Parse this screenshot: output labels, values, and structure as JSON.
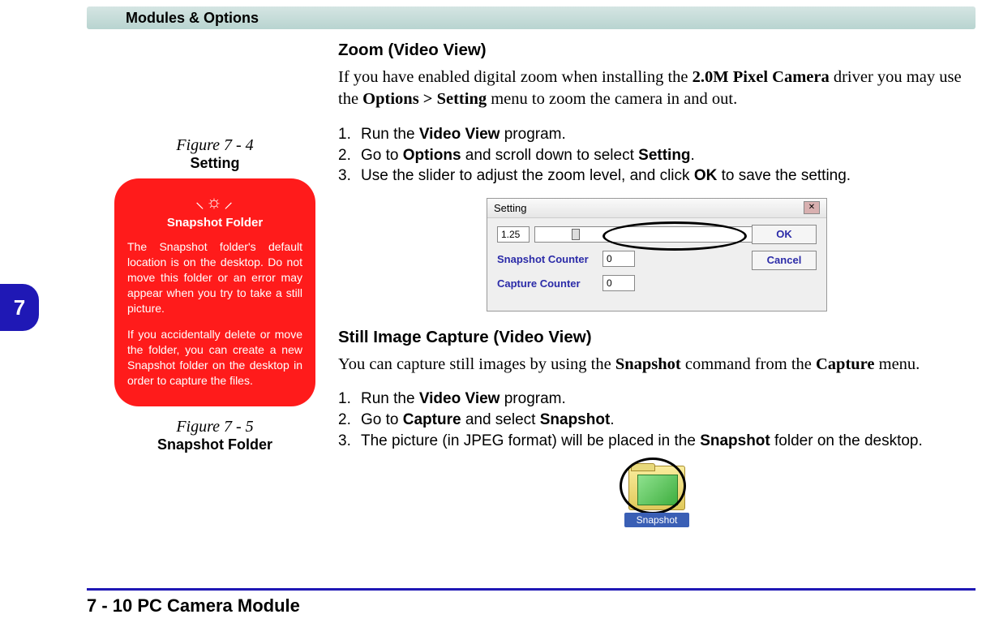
{
  "header": {
    "title": "Modules & Options"
  },
  "chapter": {
    "num": "7"
  },
  "figures": {
    "4": {
      "label": "Figure 7 - 4",
      "caption": "Setting"
    },
    "5": {
      "label": "Figure 7 - 5",
      "caption": "Snapshot Folder"
    }
  },
  "warning": {
    "title": "Snapshot Folder",
    "p1": "The Snapshot folder's default location is on the desktop. Do not move this folder or an error may appear when you try to take a still picture.",
    "p2": "If you accidentally delete or move the folder, you can create a new Snapshot folder on the desktop in order to capture the files."
  },
  "main": {
    "zoom": {
      "heading": "Zoom (Video View)",
      "intro_a": "If you have enabled digital zoom when installing the ",
      "bold1": "2.0M Pixel Camera",
      "intro_b": " driver you may use the ",
      "bold2": "Options > Setting",
      "intro_c": " menu to zoom the camera in and out.",
      "steps": {
        "1a": "Run the ",
        "1b": "Video View",
        "1c": " program.",
        "2a": "Go to ",
        "2b": "Options",
        "2c": " and scroll down to select ",
        "2d": "Setting",
        "2e": ".",
        "3a": "Use the slider to adjust the zoom level, and click ",
        "3b": "OK",
        "3c": " to save the setting."
      }
    },
    "still": {
      "heading": "Still Image Capture (Video View)",
      "intro_a": "You can capture still images by using the ",
      "bold1": "Snapshot",
      "intro_b": " command from the ",
      "bold2": "Capture",
      "intro_c": " menu.",
      "steps": {
        "1a": "Run the ",
        "1b": "Video View",
        "1c": " program.",
        "2a": "Go to ",
        "2b": "Capture",
        "2c": " and select ",
        "2d": "Snapshot",
        "2e": ".",
        "3a": "The picture (in JPEG format) will be placed in the ",
        "3b": "Snapshot",
        "3c": " folder on the desktop."
      }
    }
  },
  "dialog": {
    "title": "Setting",
    "zoom_val": "1.25",
    "snapshot_label": "Snapshot Counter",
    "snapshot_val": "0",
    "capture_label": "Capture Counter",
    "capture_val": "0",
    "ok": "OK",
    "cancel": "Cancel",
    "close": "✕"
  },
  "folder": {
    "label": "Snapshot"
  },
  "footer": {
    "text": "7 - 10 PC Camera Module"
  }
}
